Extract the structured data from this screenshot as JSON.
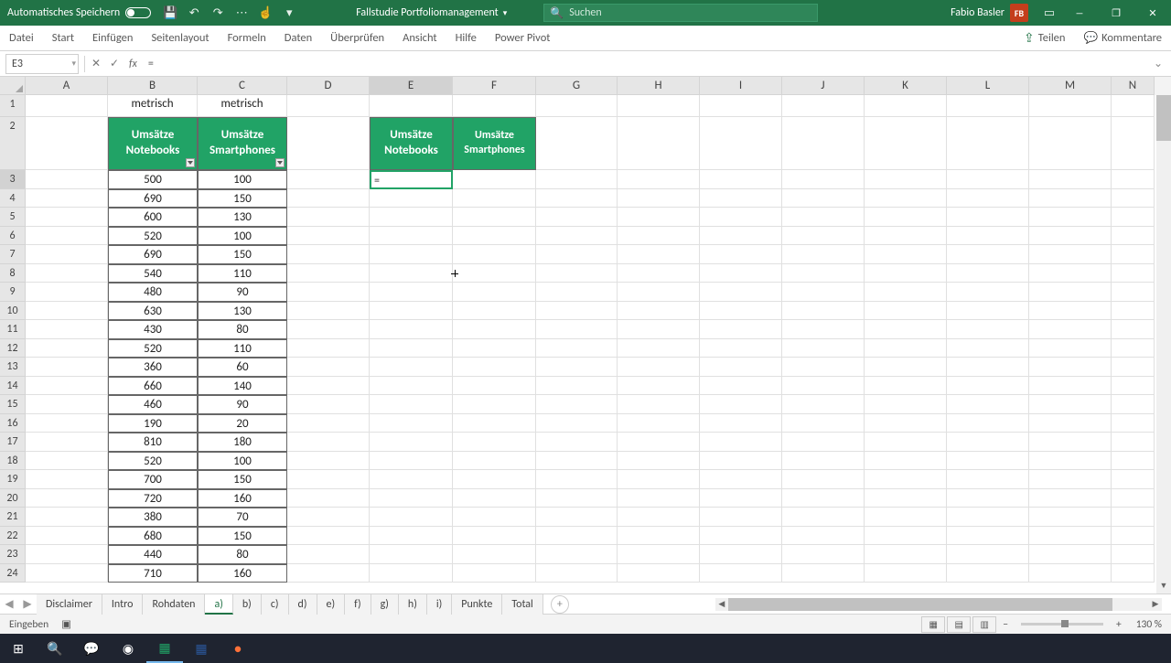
{
  "titlebar": {
    "autosave": "Automatisches Speichern",
    "filename": "Fallstudie Portfoliomanagement",
    "search_placeholder": "Suchen",
    "user_name": "Fabio Basler",
    "user_initials": "FB"
  },
  "ribbon": {
    "tabs": [
      "Datei",
      "Start",
      "Einfügen",
      "Seitenlayout",
      "Formeln",
      "Daten",
      "Überprüfen",
      "Ansicht",
      "Hilfe",
      "Power Pivot"
    ],
    "share": "Teilen",
    "comments": "Kommentare"
  },
  "formula_bar": {
    "name_box": "E3",
    "formula": "="
  },
  "columns": {
    "labels": [
      "A",
      "B",
      "C",
      "D",
      "E",
      "F",
      "G",
      "H",
      "I",
      "J",
      "K",
      "L",
      "M",
      "N"
    ],
    "widths": [
      90,
      98,
      98,
      90,
      91,
      91,
      89,
      90,
      90,
      90,
      90,
      90,
      90,
      47
    ],
    "selected_index": 4
  },
  "row_count": 24,
  "selected_row": 3,
  "green_headers": {
    "b2": "Umsätze Notebooks",
    "c2": "Umsätze Smartphones",
    "e2": "Umsätze Notebooks",
    "f2": "Umsätze Smartphones"
  },
  "metric_label": "metrisch",
  "editing_cell_value": "=",
  "data_rows": [
    {
      "b": "500",
      "c": "100"
    },
    {
      "b": "690",
      "c": "150"
    },
    {
      "b": "600",
      "c": "130"
    },
    {
      "b": "520",
      "c": "100"
    },
    {
      "b": "690",
      "c": "150"
    },
    {
      "b": "540",
      "c": "110"
    },
    {
      "b": "480",
      "c": "90"
    },
    {
      "b": "630",
      "c": "130"
    },
    {
      "b": "430",
      "c": "80"
    },
    {
      "b": "520",
      "c": "110"
    },
    {
      "b": "360",
      "c": "60"
    },
    {
      "b": "660",
      "c": "140"
    },
    {
      "b": "460",
      "c": "90"
    },
    {
      "b": "190",
      "c": "20"
    },
    {
      "b": "810",
      "c": "180"
    },
    {
      "b": "520",
      "c": "100"
    },
    {
      "b": "700",
      "c": "150"
    },
    {
      "b": "720",
      "c": "160"
    },
    {
      "b": "380",
      "c": "70"
    },
    {
      "b": "680",
      "c": "150"
    },
    {
      "b": "440",
      "c": "80"
    },
    {
      "b": "710",
      "c": "160"
    }
  ],
  "sheet_tabs": [
    "Disclaimer",
    "Intro",
    "Rohdaten",
    "a)",
    "b)",
    "c)",
    "d)",
    "e)",
    "f)",
    "g)",
    "h)",
    "i)",
    "Punkte",
    "Total"
  ],
  "active_sheet_index": 3,
  "statusbar": {
    "mode": "Eingeben",
    "zoom": "130 %"
  },
  "colors": {
    "green": "#217346",
    "cell_green": "#21a366"
  }
}
